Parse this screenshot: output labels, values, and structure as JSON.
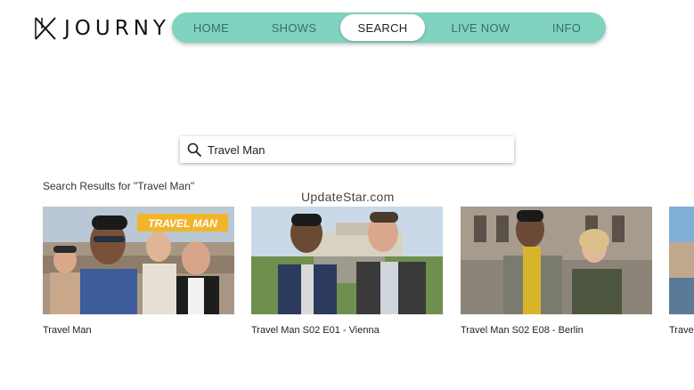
{
  "logo": {
    "text": "JOURNY",
    "icon": "journy-logo-mark"
  },
  "nav": {
    "items": [
      {
        "label": "HOME",
        "active": false
      },
      {
        "label": "SHOWS",
        "active": false
      },
      {
        "label": "SEARCH",
        "active": true
      },
      {
        "label": "LIVE NOW",
        "active": false
      },
      {
        "label": "INFO",
        "active": false
      }
    ]
  },
  "colors": {
    "nav_bg": "#7fd3bf",
    "nav_text": "#3b6e62",
    "active_bg": "#ffffff"
  },
  "search": {
    "icon": "search-icon",
    "value": "Travel Man"
  },
  "results": {
    "heading": "Search Results for \"Travel Man\"",
    "items": [
      {
        "title": "Travel Man",
        "badge": "TRAVEL MAN"
      },
      {
        "title": "Travel Man S02 E01 - Vienna"
      },
      {
        "title": "Travel Man S02 E08 - Berlin"
      },
      {
        "title": "Trave"
      }
    ]
  },
  "watermark": "UpdateStar.com"
}
